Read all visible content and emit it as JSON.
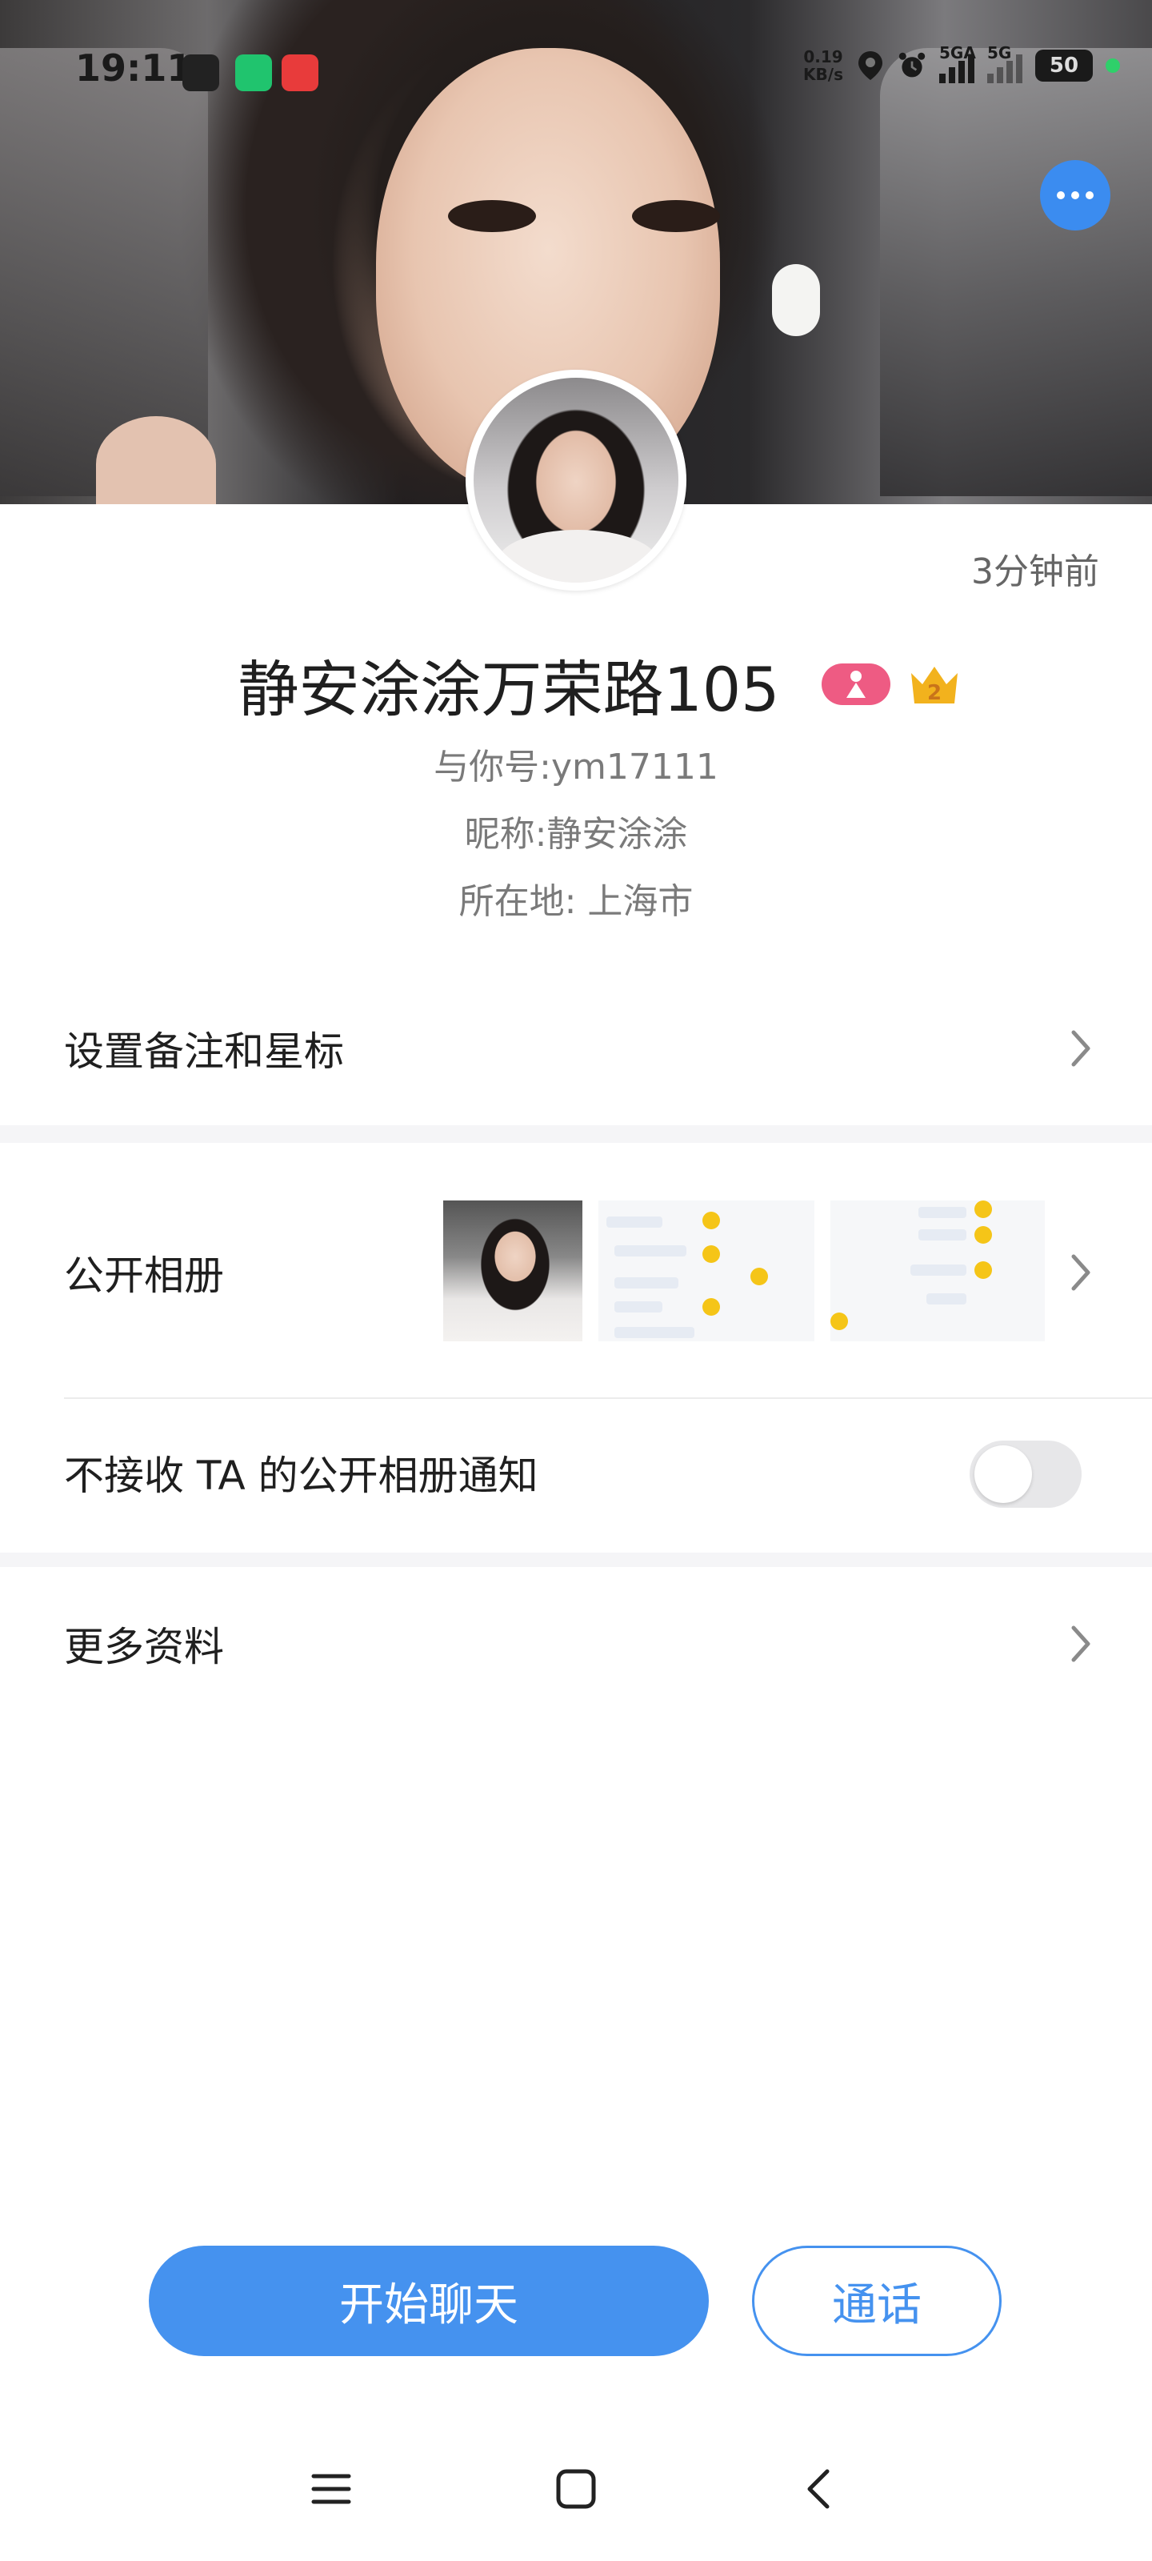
{
  "status_bar": {
    "time": "19:11",
    "net_speed_value": "0.19",
    "net_speed_unit": "KB/s",
    "signal1_label": "5GA",
    "signal2_label": "5G",
    "battery": "50",
    "app_icons": [
      "voice-recorder-icon",
      "mi-home-icon",
      "618-sale-icon"
    ]
  },
  "header": {
    "more_icon": "more-dots-icon"
  },
  "profile": {
    "last_seen": "3分钟前",
    "nickname": "静安涂涂万荣路105",
    "badges": [
      "female-badge-icon",
      "crown-level-2-icon"
    ],
    "crown_level": "2",
    "id_line": "与你号:ym17111",
    "nickname_line": "昵称:静安涂涂",
    "location_line": "所在地: 上海市"
  },
  "list": {
    "remark_label": "设置备注和星标",
    "album_label": "公开相册",
    "album_notify_label": "不接收 TA 的公开相册通知",
    "album_notify_enabled": false,
    "more_info_label": "更多资料"
  },
  "actions": {
    "chat_label": "开始聊天",
    "call_label": "通话"
  },
  "colors": {
    "accent": "#4592ef",
    "more_button": "#3b8cf0",
    "female_badge": "#ee5b83",
    "crown": "#f2b21d"
  },
  "nav": {
    "icons": [
      "menu-icon",
      "home-icon",
      "back-icon"
    ]
  }
}
